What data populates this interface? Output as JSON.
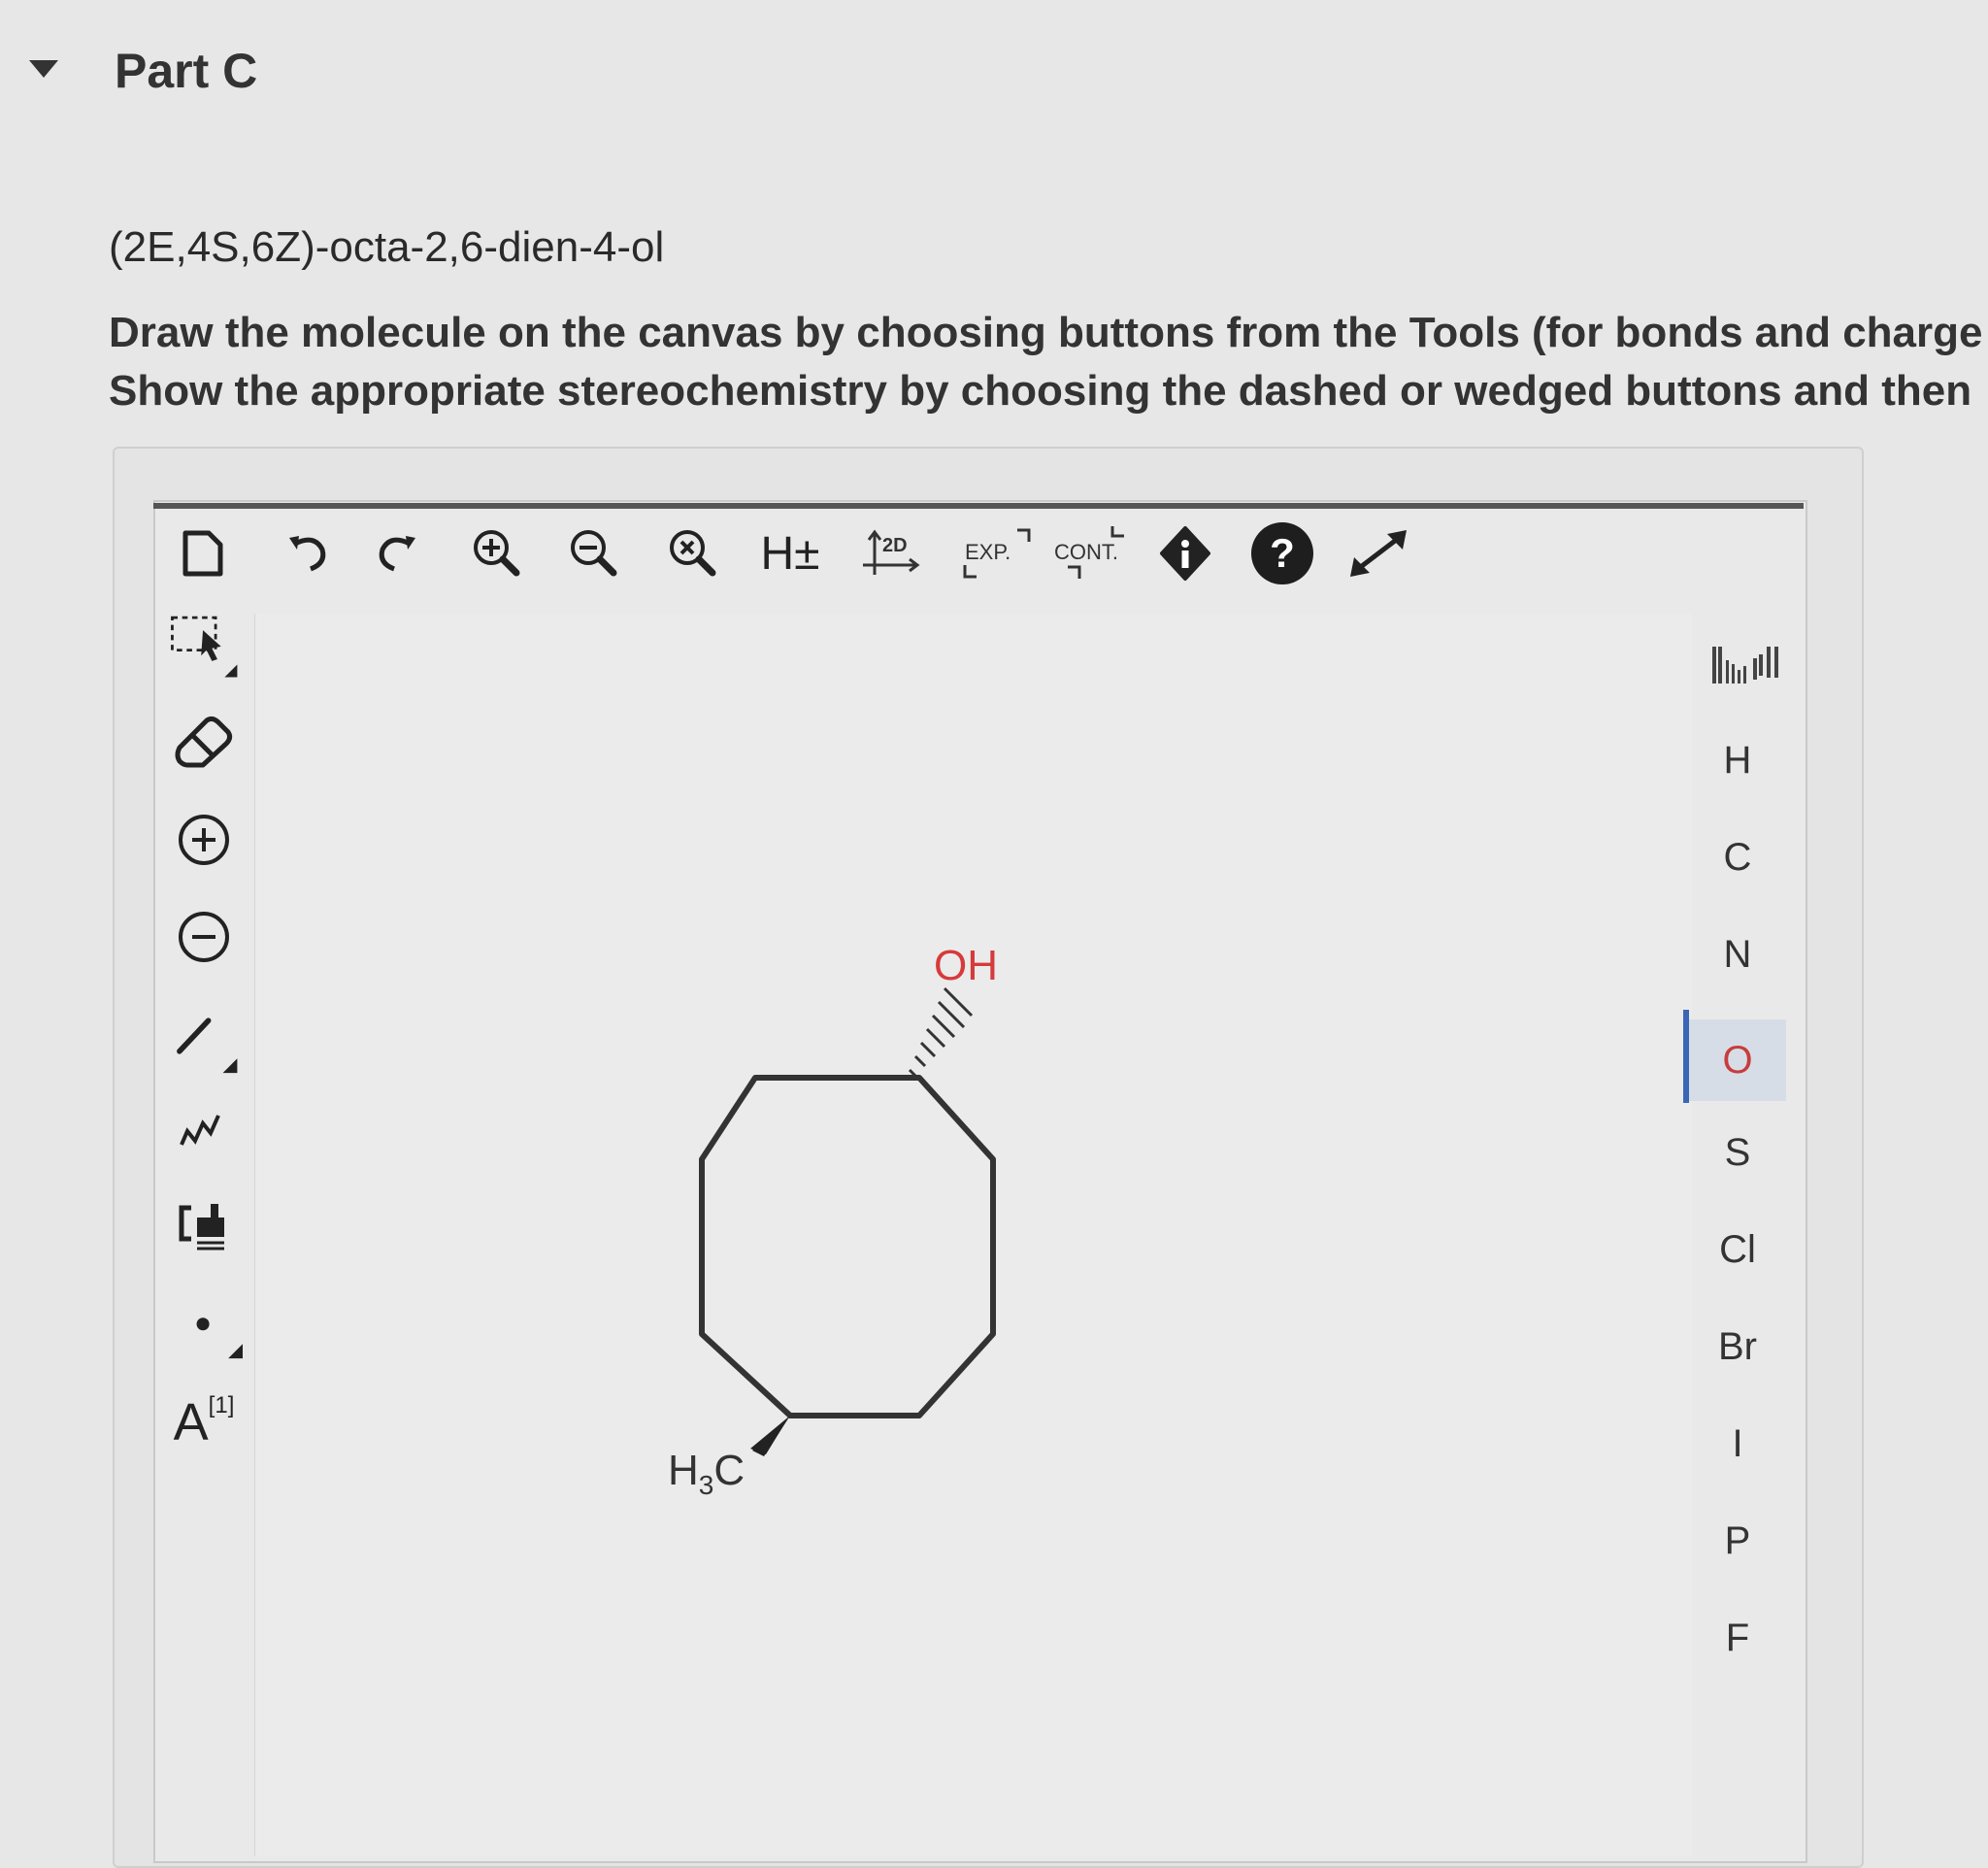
{
  "part": {
    "title": "Part C"
  },
  "question": {
    "molecule_name": "(2E,4S,6Z)-octa-2,6-dien-4-ol",
    "instruction_line1": "Draw the molecule on the canvas by choosing buttons from the Tools (for bonds and charge",
    "instruction_line2": "Show the appropriate stereochemistry by choosing the dashed or wedged buttons and then"
  },
  "toolbar": {
    "h_toggle": "H±",
    "clean2d": "2D",
    "expand": "EXP.",
    "contract": "CONT."
  },
  "sidebar": {
    "atom_map_letter": "A",
    "atom_map_sup": "[1]"
  },
  "elements": [
    {
      "symbol": "H"
    },
    {
      "symbol": "C"
    },
    {
      "symbol": "N"
    },
    {
      "symbol": "O",
      "selected": true
    },
    {
      "symbol": "S"
    },
    {
      "symbol": "Cl"
    },
    {
      "symbol": "Br"
    },
    {
      "symbol": "I"
    },
    {
      "symbol": "P"
    },
    {
      "symbol": "F"
    }
  ],
  "molecule": {
    "oh_label": "OH",
    "methyl_label_main": "H",
    "methyl_label_sub": "3",
    "methyl_label_tail": "C"
  },
  "colors": {
    "oxygen": "#d63a3a",
    "selection_bar": "#3a66b8",
    "icon_dark": "#222222"
  },
  "icons": {
    "toolbar": [
      "new-document-icon",
      "undo-icon",
      "redo-icon",
      "zoom-in-icon",
      "zoom-out-icon",
      "zoom-reset-icon",
      "hydrogen-toggle-icon",
      "clean-2d-icon",
      "expand-icon",
      "contract-icon",
      "info-icon",
      "help-icon",
      "fullscreen-icon"
    ],
    "sidebar": [
      "selection-tool-icon",
      "eraser-icon",
      "positive-charge-icon",
      "negative-charge-icon",
      "single-bond-icon",
      "chain-tool-icon",
      "bracket-tool-icon",
      "radical-dot-icon",
      "atom-map-icon"
    ]
  }
}
